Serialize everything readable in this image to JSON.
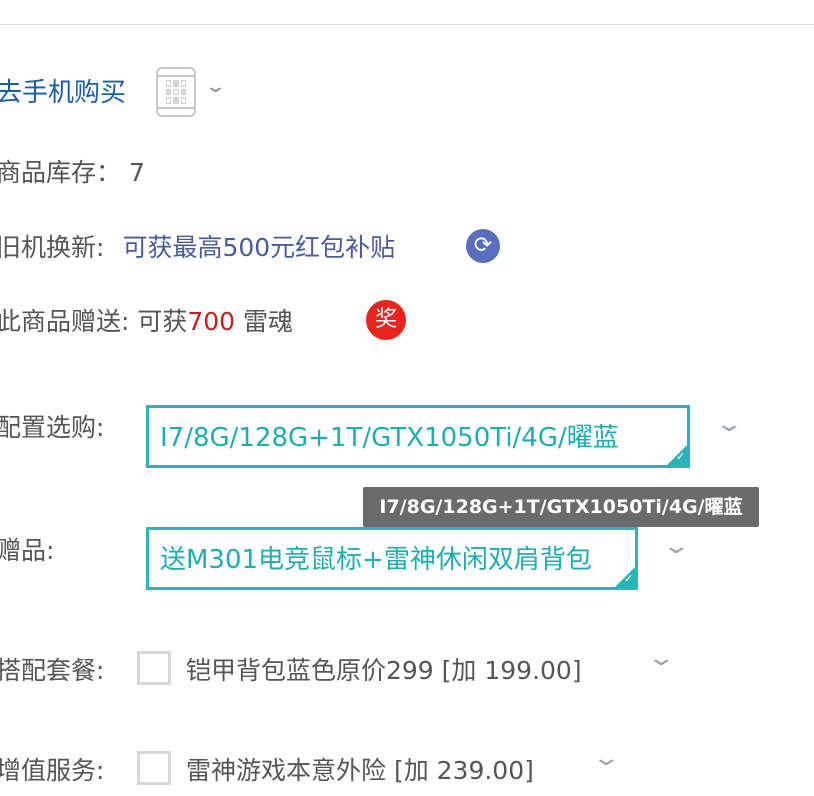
{
  "mobile_buy": {
    "link_text": "去手机购买",
    "qr_icon": "qr-phone-icon",
    "expand_icon": "chevron-down-icon"
  },
  "stock": {
    "label": "商品库存：",
    "value": "7"
  },
  "trade_in": {
    "label": "旧机换新:",
    "link_text": "可获最高500元红包补贴",
    "icon": "refresh-icon",
    "icon_color": "#5a6ec0"
  },
  "gift_points": {
    "label": "此商品赠送: 可获",
    "amount": "700",
    "unit": "雷魂",
    "badge": "奖",
    "amount_color": "#c0201e",
    "badge_color": "#e8241e"
  },
  "config": {
    "label": "配置选购:",
    "selected": "I7/8G/128G+1T/GTX1050Ti/4G/曜蓝",
    "tooltip": "I7/8G/128G+1T/GTX1050Ti/4G/曜蓝"
  },
  "gift": {
    "label": "赠品:",
    "selected": "送M301电竞鼠标+雷神休闲双肩背包"
  },
  "bundle": {
    "label": "搭配套餐:",
    "option_text": "铠甲背包蓝色原价299 [加 199.00]",
    "checked": false
  },
  "service": {
    "label": "增值服务:",
    "option_text": "雷神游戏本意外险 [加 239.00]",
    "checked": false
  },
  "colors": {
    "accent": "#2cb5b8",
    "link": "#1a5ea8"
  }
}
